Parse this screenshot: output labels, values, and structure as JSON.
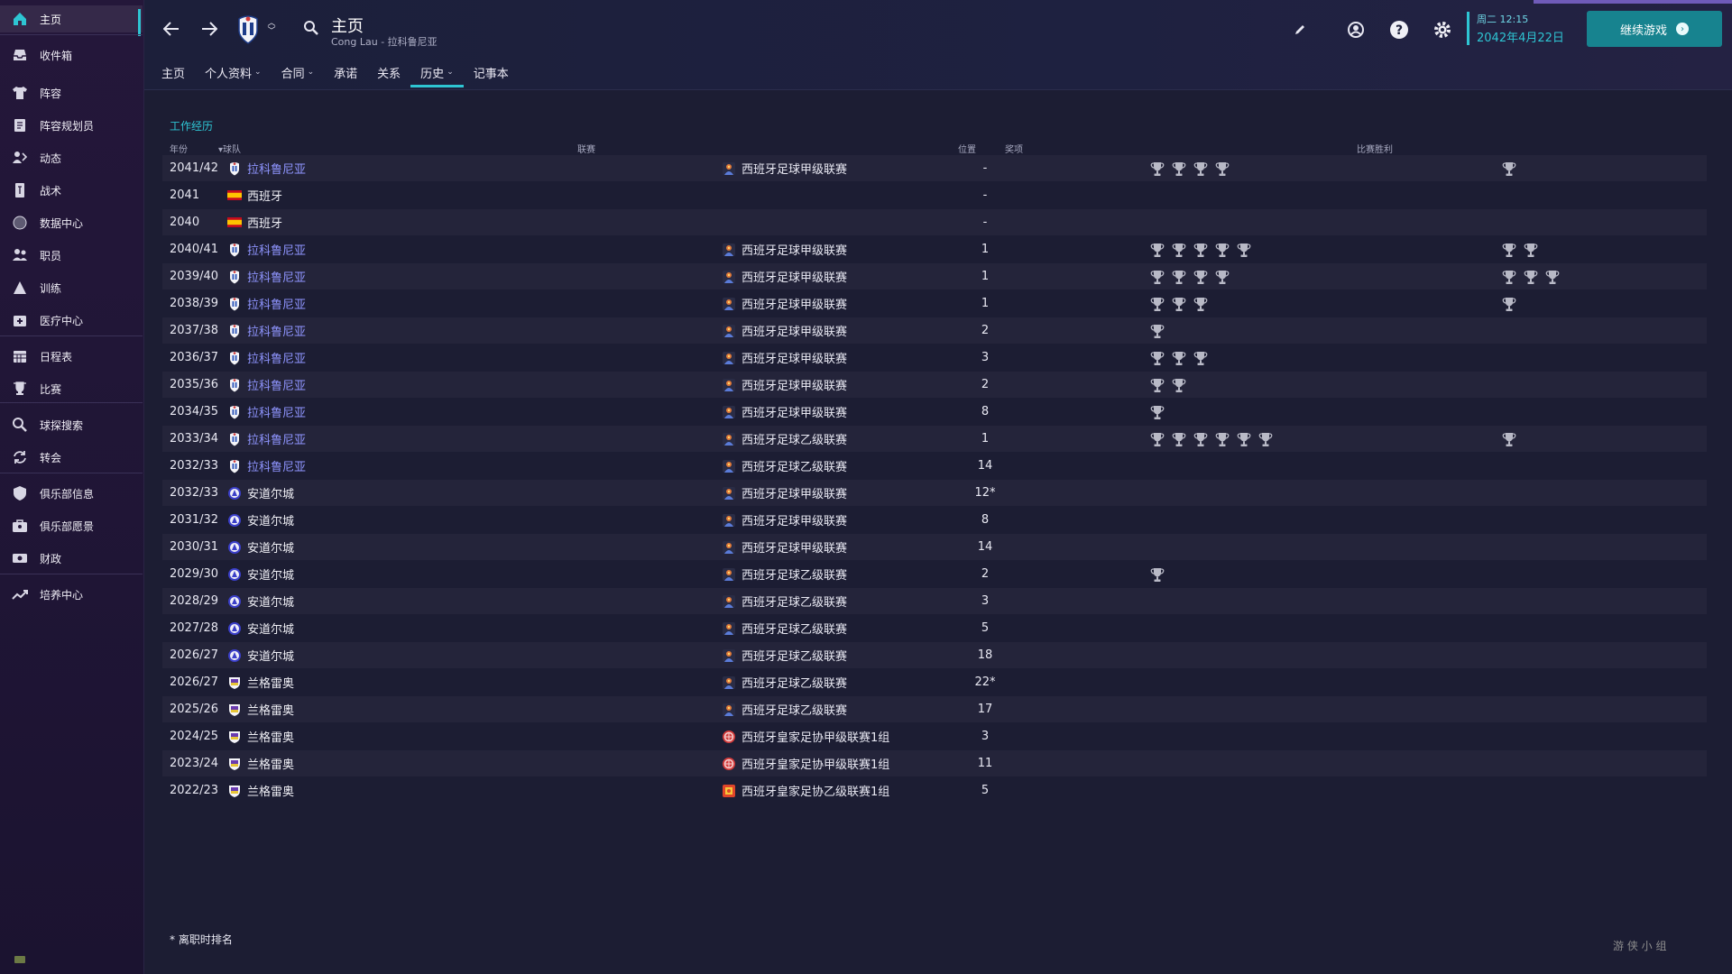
{
  "sidebar": {
    "items": [
      {
        "label": "主页",
        "icon": "home-icon"
      },
      {
        "label": "收件箱",
        "icon": "inbox-icon"
      },
      {
        "label": "阵容",
        "icon": "shirt-icon"
      },
      {
        "label": "阵容规划员",
        "icon": "clipboard-icon"
      },
      {
        "label": "动态",
        "icon": "dynamics-icon"
      },
      {
        "label": "战术",
        "icon": "tactics-icon"
      },
      {
        "label": "数据中心",
        "icon": "data-icon"
      },
      {
        "label": "职员",
        "icon": "staff-icon"
      },
      {
        "label": "训练",
        "icon": "training-icon"
      },
      {
        "label": "医疗中心",
        "icon": "medical-icon"
      },
      {
        "label": "日程表",
        "icon": "calendar-icon"
      },
      {
        "label": "比赛",
        "icon": "trophy-icon"
      },
      {
        "label": "球探搜索",
        "icon": "scouting-icon"
      },
      {
        "label": "转会",
        "icon": "transfer-icon"
      },
      {
        "label": "俱乐部信息",
        "icon": "shield-icon"
      },
      {
        "label": "俱乐部愿景",
        "icon": "briefcase-icon"
      },
      {
        "label": "财政",
        "icon": "finance-icon"
      },
      {
        "label": "培养中心",
        "icon": "development-icon"
      }
    ]
  },
  "header": {
    "title": "主页",
    "subtitle": "Cong Lau - 拉科鲁尼亚",
    "date_top": "周二 12:15",
    "date_bottom": "2042年4月22日",
    "continue_label": "继续游戏"
  },
  "tabs": [
    {
      "label": "主页",
      "caret": false
    },
    {
      "label": "个人资料",
      "caret": true
    },
    {
      "label": "合同",
      "caret": true
    },
    {
      "label": "承诺",
      "caret": false
    },
    {
      "label": "关系",
      "caret": false
    },
    {
      "label": "历史",
      "caret": true,
      "active": true
    },
    {
      "label": "记事本",
      "caret": false
    }
  ],
  "history": {
    "section_title": "工作经历",
    "columns": {
      "year": "年份",
      "team": "球队",
      "league": "联赛",
      "position": "位置",
      "awards": "奖项",
      "cup_wins": "比赛胜利"
    },
    "rows": [
      {
        "year": "2041/42",
        "team": "拉科鲁尼亚",
        "team_type": "depor",
        "league": "西班牙足球甲级联赛",
        "league_type": "laliga",
        "position": "-",
        "awards": 4,
        "cup_wins": 1
      },
      {
        "year": "2041",
        "team": "西班牙",
        "team_type": "spain",
        "league": "",
        "league_type": "",
        "position": "-",
        "awards": 0,
        "cup_wins": 0
      },
      {
        "year": "2040",
        "team": "西班牙",
        "team_type": "spain",
        "league": "",
        "league_type": "",
        "position": "-",
        "awards": 0,
        "cup_wins": 0
      },
      {
        "year": "2040/41",
        "team": "拉科鲁尼亚",
        "team_type": "depor",
        "league": "西班牙足球甲级联赛",
        "league_type": "laliga",
        "position": "1",
        "awards": 5,
        "cup_wins": 2
      },
      {
        "year": "2039/40",
        "team": "拉科鲁尼亚",
        "team_type": "depor",
        "league": "西班牙足球甲级联赛",
        "league_type": "laliga",
        "position": "1",
        "awards": 4,
        "cup_wins": 3
      },
      {
        "year": "2038/39",
        "team": "拉科鲁尼亚",
        "team_type": "depor",
        "league": "西班牙足球甲级联赛",
        "league_type": "laliga",
        "position": "1",
        "awards": 3,
        "cup_wins": 1
      },
      {
        "year": "2037/38",
        "team": "拉科鲁尼亚",
        "team_type": "depor",
        "league": "西班牙足球甲级联赛",
        "league_type": "laliga",
        "position": "2",
        "awards": 1,
        "cup_wins": 0
      },
      {
        "year": "2036/37",
        "team": "拉科鲁尼亚",
        "team_type": "depor",
        "league": "西班牙足球甲级联赛",
        "league_type": "laliga",
        "position": "3",
        "awards": 3,
        "cup_wins": 0
      },
      {
        "year": "2035/36",
        "team": "拉科鲁尼亚",
        "team_type": "depor",
        "league": "西班牙足球甲级联赛",
        "league_type": "laliga",
        "position": "2",
        "awards": 2,
        "cup_wins": 0
      },
      {
        "year": "2034/35",
        "team": "拉科鲁尼亚",
        "team_type": "depor",
        "league": "西班牙足球甲级联赛",
        "league_type": "laliga",
        "position": "8",
        "awards": 1,
        "cup_wins": 0
      },
      {
        "year": "2033/34",
        "team": "拉科鲁尼亚",
        "team_type": "depor",
        "league": "西班牙足球乙级联赛",
        "league_type": "laliga",
        "position": "1",
        "awards": 6,
        "cup_wins": 1
      },
      {
        "year": "2032/33",
        "team": "拉科鲁尼亚",
        "team_type": "depor",
        "league": "西班牙足球乙级联赛",
        "league_type": "laliga",
        "position": "14",
        "awards": 0,
        "cup_wins": 0
      },
      {
        "year": "2032/33",
        "team": "安道尔城",
        "team_type": "andorra",
        "league": "西班牙足球甲级联赛",
        "league_type": "laliga",
        "position": "12*",
        "awards": 0,
        "cup_wins": 0
      },
      {
        "year": "2031/32",
        "team": "安道尔城",
        "team_type": "andorra",
        "league": "西班牙足球甲级联赛",
        "league_type": "laliga",
        "position": "8",
        "awards": 0,
        "cup_wins": 0
      },
      {
        "year": "2030/31",
        "team": "安道尔城",
        "team_type": "andorra",
        "league": "西班牙足球甲级联赛",
        "league_type": "laliga",
        "position": "14",
        "awards": 0,
        "cup_wins": 0
      },
      {
        "year": "2029/30",
        "team": "安道尔城",
        "team_type": "andorra",
        "league": "西班牙足球乙级联赛",
        "league_type": "laliga",
        "position": "2",
        "awards": 1,
        "cup_wins": 0
      },
      {
        "year": "2028/29",
        "team": "安道尔城",
        "team_type": "andorra",
        "league": "西班牙足球乙级联赛",
        "league_type": "laliga",
        "position": "3",
        "awards": 0,
        "cup_wins": 0
      },
      {
        "year": "2027/28",
        "team": "安道尔城",
        "team_type": "andorra",
        "league": "西班牙足球乙级联赛",
        "league_type": "laliga",
        "position": "5",
        "awards": 0,
        "cup_wins": 0
      },
      {
        "year": "2026/27",
        "team": "安道尔城",
        "team_type": "andorra",
        "league": "西班牙足球乙级联赛",
        "league_type": "laliga",
        "position": "18",
        "awards": 0,
        "cup_wins": 0
      },
      {
        "year": "2026/27",
        "team": "兰格雷奥",
        "team_type": "langreo",
        "league": "西班牙足球乙级联赛",
        "league_type": "laliga",
        "position": "22*",
        "awards": 0,
        "cup_wins": 0
      },
      {
        "year": "2025/26",
        "team": "兰格雷奥",
        "team_type": "langreo",
        "league": "西班牙足球乙级联赛",
        "league_type": "laliga",
        "position": "17",
        "awards": 0,
        "cup_wins": 0
      },
      {
        "year": "2024/25",
        "team": "兰格雷奥",
        "team_type": "langreo",
        "league": "西班牙皇家足协甲级联赛1组",
        "league_type": "rfef1",
        "position": "3",
        "awards": 0,
        "cup_wins": 0
      },
      {
        "year": "2023/24",
        "team": "兰格雷奥",
        "team_type": "langreo",
        "league": "西班牙皇家足协甲级联赛1组",
        "league_type": "rfef1",
        "position": "11",
        "awards": 0,
        "cup_wins": 0
      },
      {
        "year": "2022/23",
        "team": "兰格雷奥",
        "team_type": "langreo",
        "league": "西班牙皇家足协乙级联赛1组",
        "league_type": "rfef2",
        "position": "5",
        "awards": 0,
        "cup_wins": 0
      }
    ],
    "footnote": "* 离职时排名"
  },
  "watermark": "游 侠 小 组",
  "colors": {
    "accent": "#2ec5d3",
    "link": "#8f95ff",
    "continue_button": "#17838f",
    "sidebar_bg": "#24173a",
    "main_bg": "#1c1d33"
  }
}
